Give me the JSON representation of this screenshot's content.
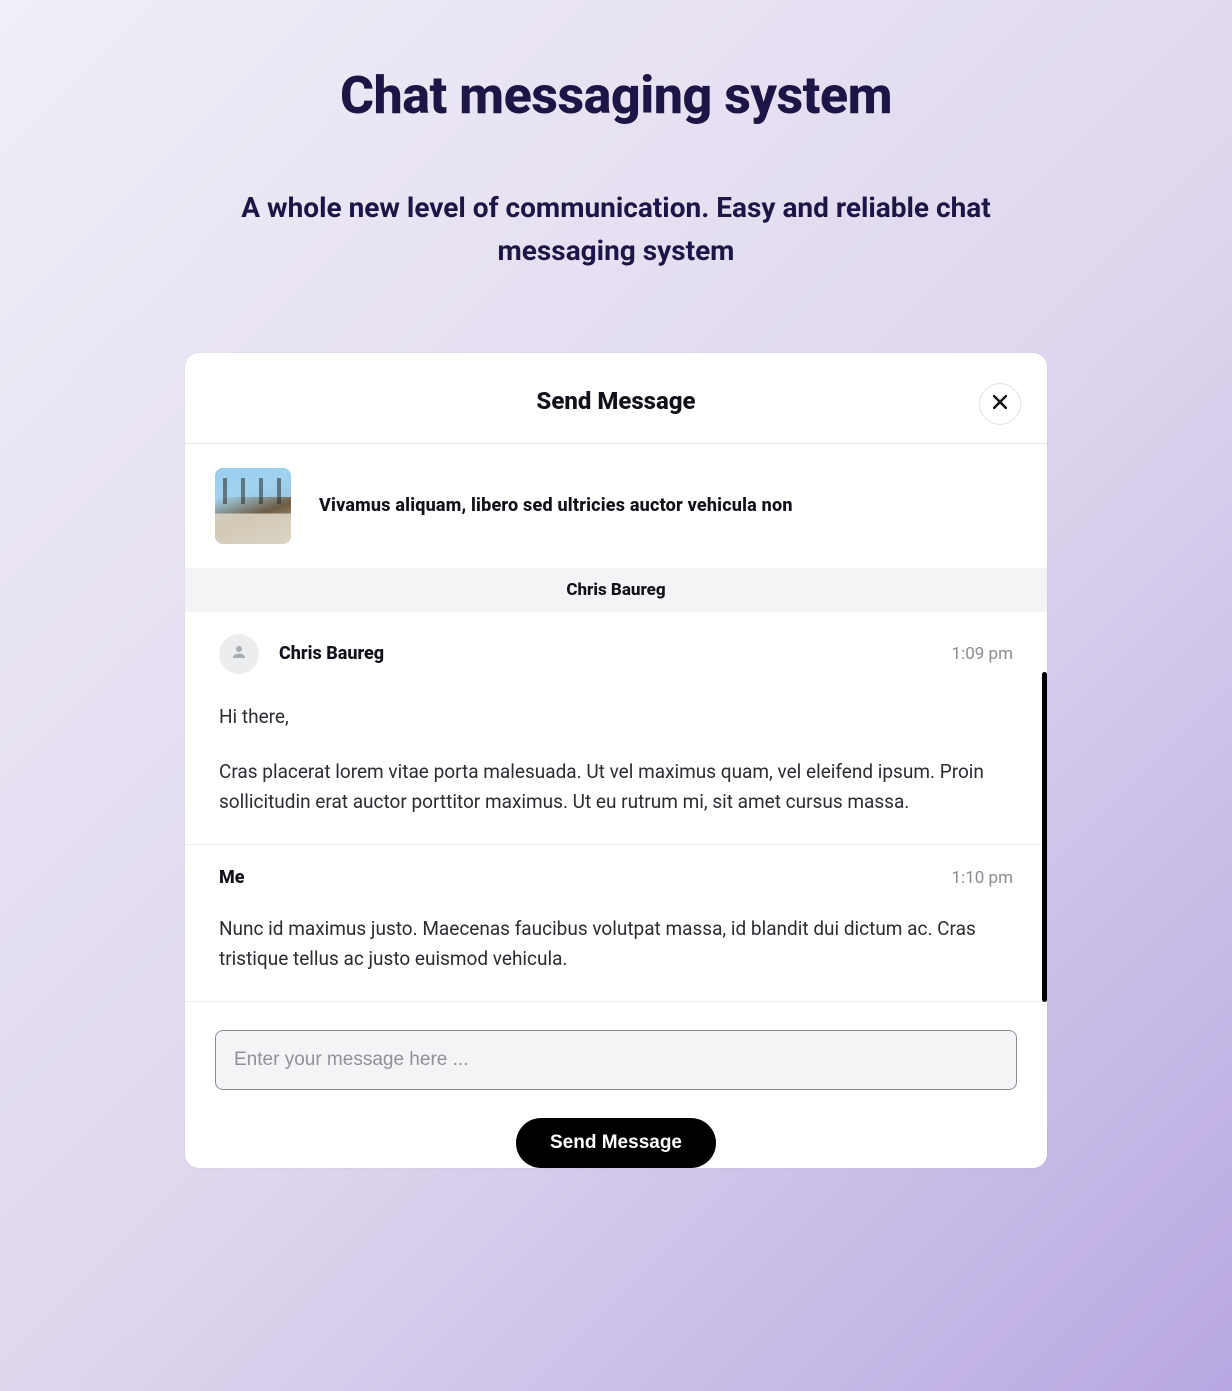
{
  "page": {
    "title": "Chat messaging system",
    "subtitle": "A whole new level of communication. Easy and reliable chat messaging system"
  },
  "modal": {
    "title": "Send Message",
    "close_icon": "close-icon",
    "topic": {
      "thumb_alt": "listing-photo",
      "title": "Vivamus aliquam, libero sed ultricies auctor vehicula non"
    },
    "participant": "Chris Baureg",
    "messages": [
      {
        "author": "Chris Baureg",
        "is_me": false,
        "time": "1:09 pm",
        "paragraphs": [
          "Hi there,",
          "Cras placerat lorem vitae porta malesuada. Ut vel maximus quam, vel eleifend ipsum. Proin sollicitudin erat auctor porttitor maximus. Ut eu rutrum mi, sit amet cursus massa."
        ]
      },
      {
        "author": "Me",
        "is_me": true,
        "time": "1:10 pm",
        "paragraphs": [
          "Nunc id maximus justo. Maecenas faucibus volutpat massa, id blandit dui dictum ac. Cras tristique tellus ac justo euismod vehicula."
        ]
      }
    ],
    "compose": {
      "placeholder": "Enter your message here ...",
      "value": "",
      "send_label": "Send Message"
    }
  }
}
